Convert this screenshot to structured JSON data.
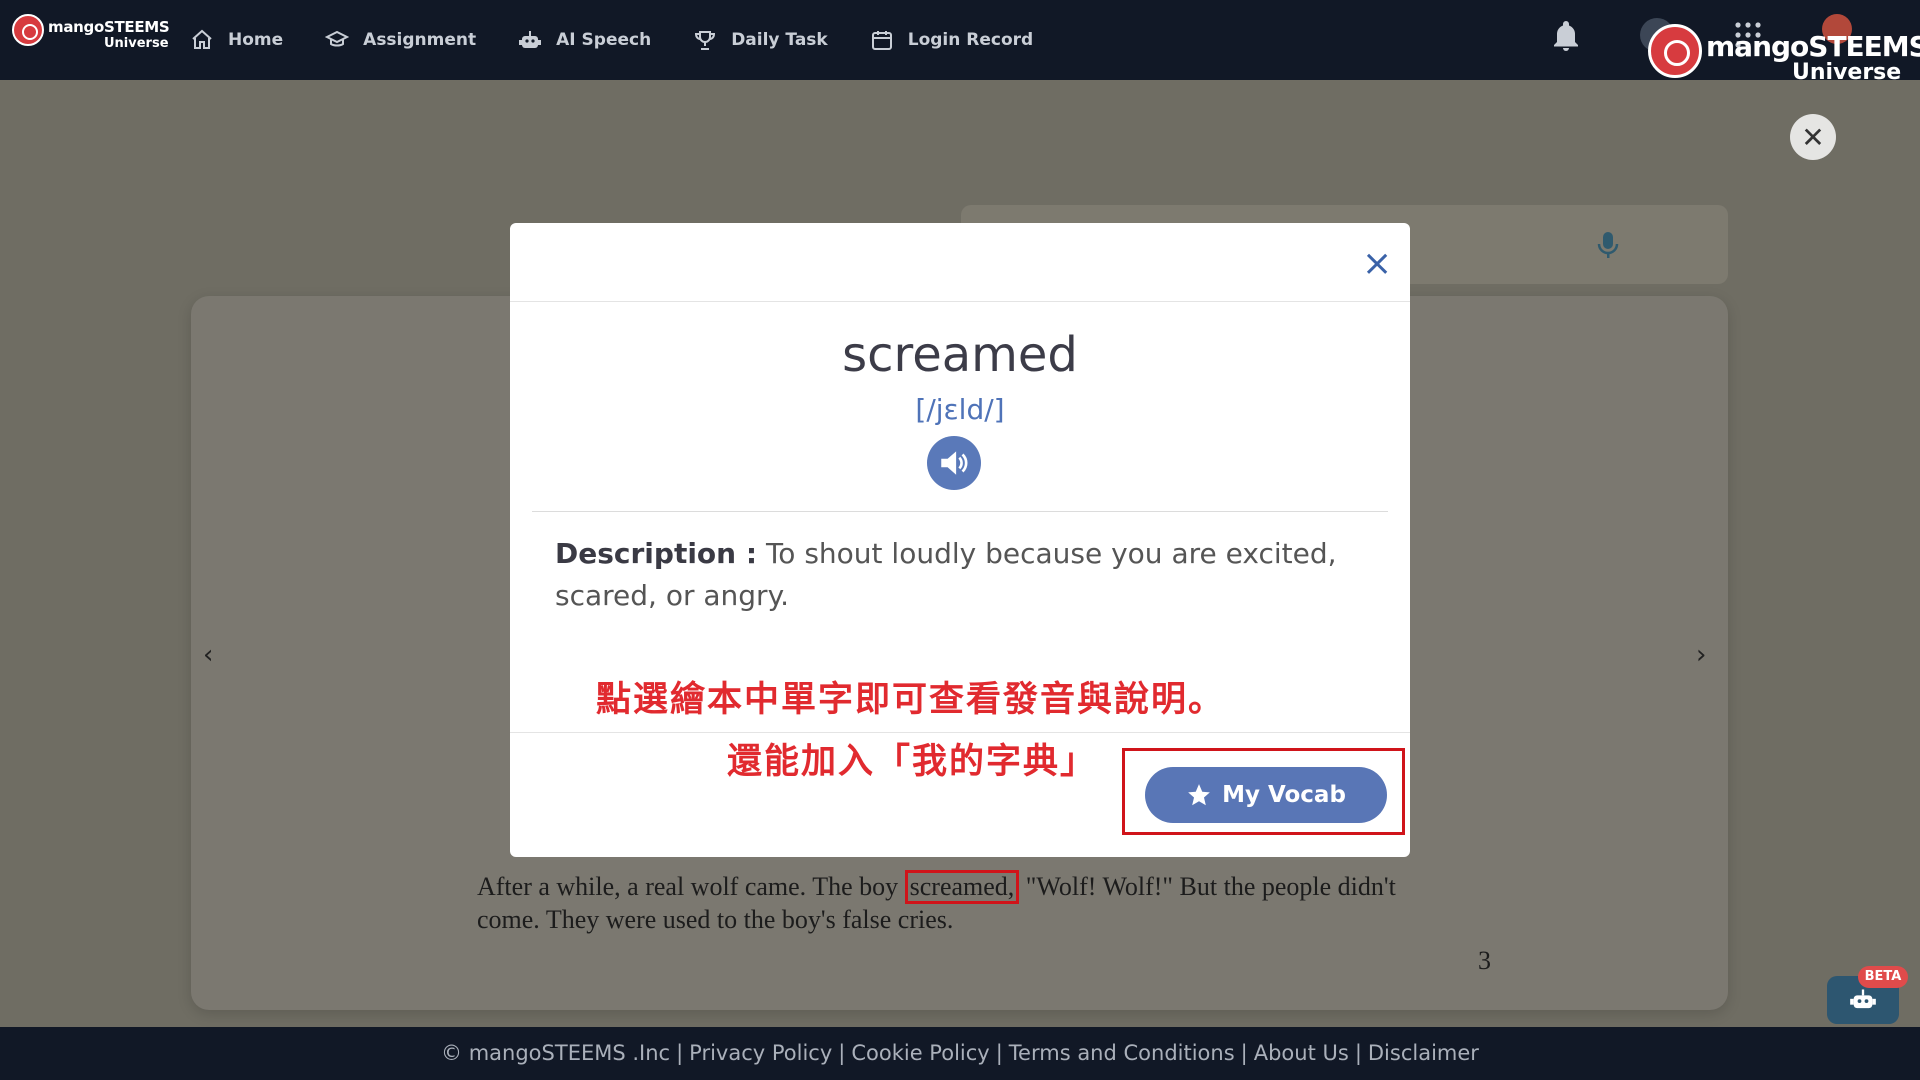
{
  "nav": {
    "logo_small": {
      "brand": "mangoSTEEMS",
      "sub": "Universe"
    },
    "items": [
      {
        "label": "Home",
        "icon": "home-icon"
      },
      {
        "label": "Assignment",
        "icon": "graduation-cap-icon"
      },
      {
        "label": "AI Speech",
        "icon": "robot-icon"
      },
      {
        "label": "Daily Task",
        "icon": "trophy-icon"
      },
      {
        "label": "Login Record",
        "icon": "calendar-icon"
      }
    ],
    "logo_big": {
      "brand": "mangoSTEEMS",
      "sub": "Universe"
    }
  },
  "reader": {
    "story_before": "After a while, a real wolf came. The boy ",
    "story_highlight": "screamed,",
    "story_after": " \"Wolf! Wolf!\" But the people didn't come. They were used to the boy's false cries.",
    "page_number": "3"
  },
  "modal": {
    "word": "screamed",
    "phonetic": "[/jɛld/]",
    "description_label": "Description :",
    "description_text": " To shout loudly because you are excited, scared, or angry.",
    "annotation_line1": "點選繪本中單字即可查看發音與說明。",
    "annotation_line2": "還能加入「我的字典」",
    "vocab_button": "My Vocab"
  },
  "footer": {
    "links": [
      "© mangoSTEEMS .Inc",
      "Privacy Policy",
      "Cookie Policy",
      "Terms and Conditions",
      "About Us",
      "Disclaimer"
    ]
  },
  "chatbot": {
    "badge": "BETA"
  },
  "colors": {
    "nav_bg": "#111826",
    "accent": "#5976b6",
    "annotation_red": "#e12a2f"
  }
}
